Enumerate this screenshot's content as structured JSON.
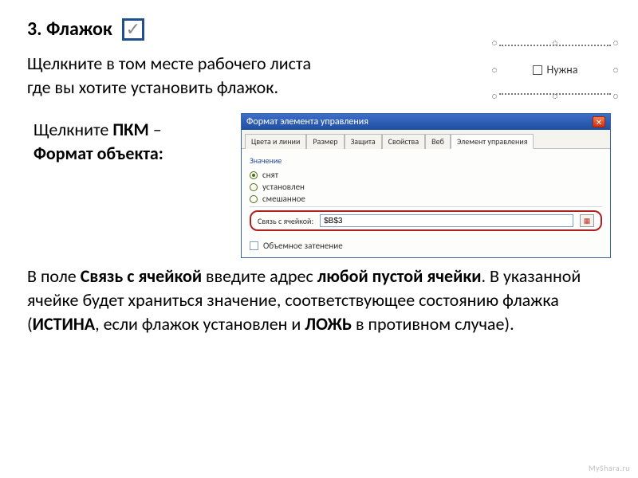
{
  "heading": "3. Флажок",
  "para1_line1": "Щелкните в том месте рабочего листа",
  "para1_line2": "где вы хотите установить флажок.",
  "embed_label": "Нужна",
  "para2_pre": "Щелкните ",
  "para2_b1": "ПКМ",
  "para2_mid": " – ",
  "para2_b2": "Формат объекта:",
  "dialog": {
    "title": "Формат элемента управления",
    "tabs": {
      "t0": "Цвета и линии",
      "t1": "Размер",
      "t2": "Защита",
      "t3": "Свойства",
      "t4": "Веб",
      "t5": "Элемент управления"
    },
    "group_value_label": "Значение",
    "radio_unset": "снят",
    "radio_set": "установлен",
    "radio_mixed": "смешанное",
    "cell_link_label": "Связь с ячейкой:",
    "cell_link_value": "$B$3",
    "shadow_label": "Объемное затенение"
  },
  "para3_pre": "В поле ",
  "para3_b1": "Связь с ячейкой",
  "para3_mid1": " введите адрес ",
  "para3_b2": "любой пустой ячейки",
  "para3_mid2": ". В указанной ячейке будет храниться значение, соответствующее состоянию флажка (",
  "para3_b3": "ИСТИНА",
  "para3_mid3": ", если флажок установлен и ",
  "para3_b4": "ЛОЖЬ",
  "para3_mid4": " в противном случае).",
  "watermark": "MyShara.ru"
}
